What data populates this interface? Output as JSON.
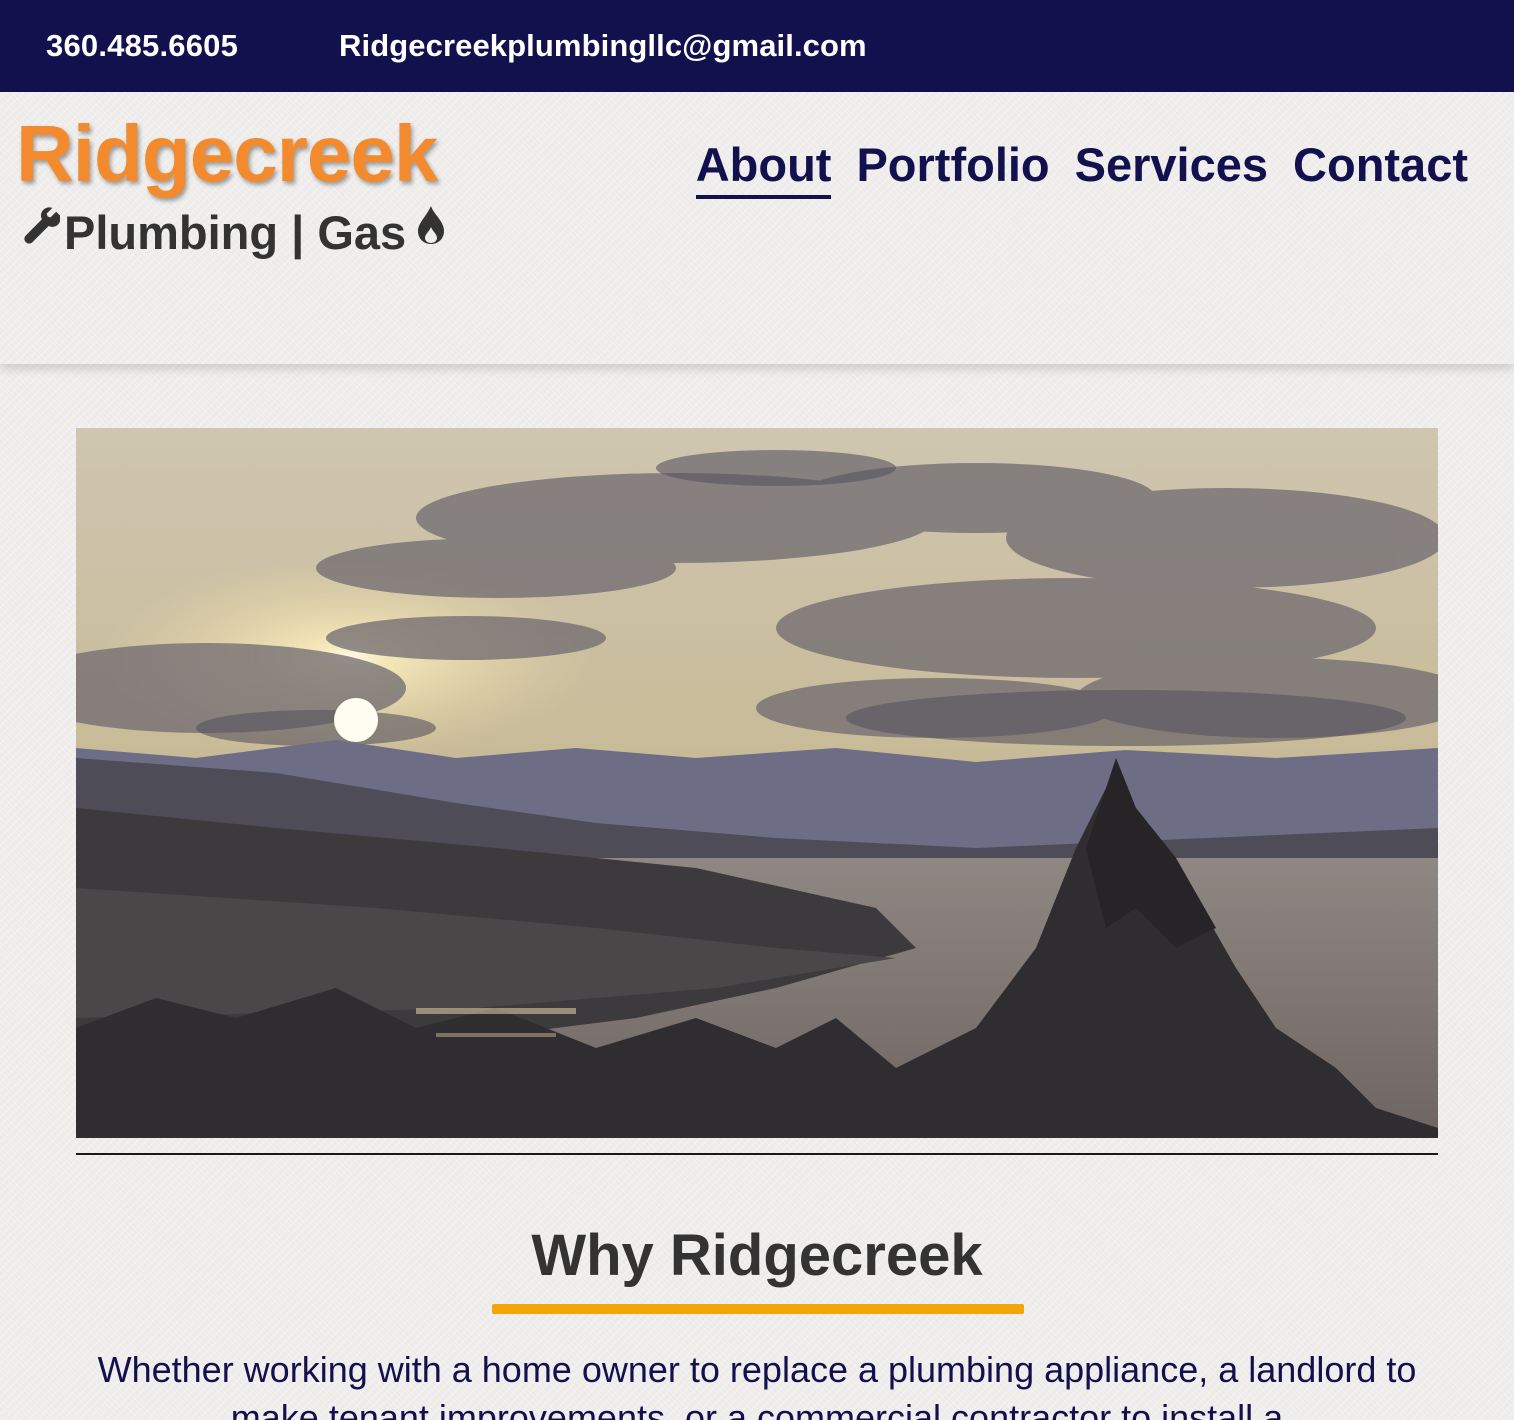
{
  "topbar": {
    "phone": "360.485.6605",
    "email": "Ridgecreekplumbingllc@gmail.com"
  },
  "logo": {
    "title": "Ridgecreek",
    "subtitle": "Plumbing | Gas",
    "icons": [
      "wrench-icon",
      "flame-icon"
    ]
  },
  "nav": {
    "items": [
      {
        "label": "About",
        "active": true
      },
      {
        "label": "Portfolio",
        "active": false
      },
      {
        "label": "Services",
        "active": false
      },
      {
        "label": "Contact",
        "active": false
      }
    ]
  },
  "why": {
    "title": "Why Ridgecreek",
    "text": "Whether working with a home owner to replace a plumbing appliance, a landlord to make tenant improvements, or a commercial contractor to install a"
  },
  "colors": {
    "topbar": "#13104e",
    "nav_text": "#13104e",
    "logo_orange": "#f38b2e",
    "accent_underline": "#f4a50a",
    "body_text": "#333333"
  }
}
